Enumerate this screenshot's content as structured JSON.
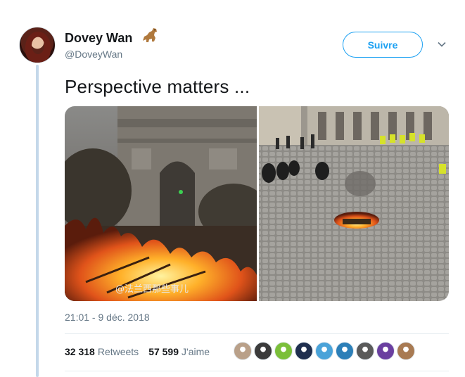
{
  "author": {
    "name": "Dovey Wan",
    "handle": "@DoveyWan",
    "emoji_icon": "dinosaur-icon"
  },
  "follow_button": {
    "label": "Suivre"
  },
  "tweet": {
    "text": "Perspective matters ...",
    "timestamp": "21:01 - 9 déc. 2018",
    "watermark": "@法兰西那些事儿"
  },
  "stats": {
    "retweets_count": "32 318",
    "retweets_label": "Retweets",
    "likes_count": "57 599",
    "likes_label": "J'aime"
  },
  "likers": [
    {
      "color": "#b9a089"
    },
    {
      "color": "#3b3b3b"
    },
    {
      "color": "#7bbf3a"
    },
    {
      "color": "#1f2f4f"
    },
    {
      "color": "#4aa3d9"
    },
    {
      "color": "#2c7fb8"
    },
    {
      "color": "#5a5a5a"
    },
    {
      "color": "#6a3fa0"
    },
    {
      "color": "#a87a52"
    }
  ],
  "colors": {
    "accent": "#1da1f2",
    "text": "#14171a",
    "muted": "#657786"
  }
}
